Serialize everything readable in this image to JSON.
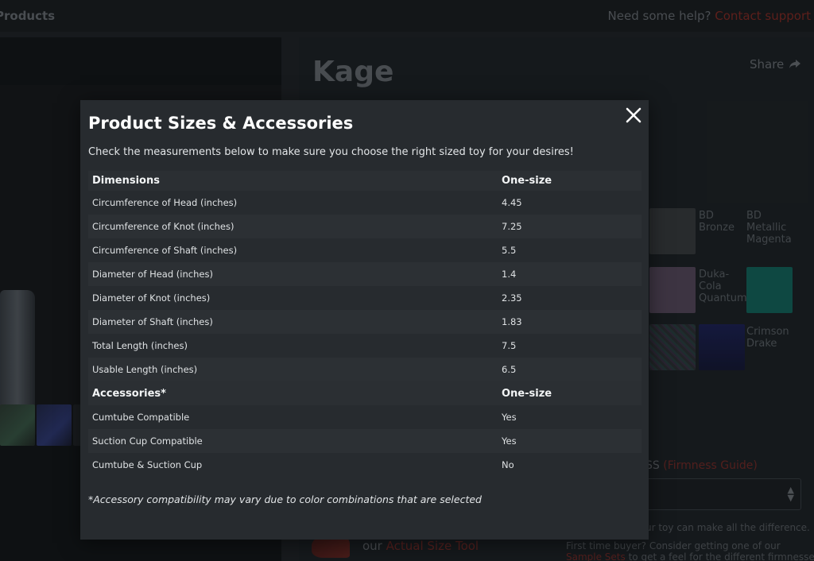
{
  "header": {
    "breadcrumb": "Products",
    "help_text": "Need some help?",
    "help_link": "Contact support"
  },
  "product": {
    "name": "Kage",
    "share_label": "Share"
  },
  "swatches": [
    {
      "label": "",
      "color": "#3a3c3e"
    },
    {
      "label": "BD Bronze",
      "color": ""
    },
    {
      "label": "BD Metallic Magenta",
      "color": ""
    },
    {
      "label": "",
      "color": "#5a4a5e"
    },
    {
      "label": "Duka-Cola Quantum",
      "color": ""
    },
    {
      "label": "",
      "color": "#12695e"
    },
    {
      "label": "",
      "color": "#2d3033"
    },
    {
      "label": "",
      "color": "#1a1e4a"
    },
    {
      "label": "Crimson Drake",
      "color": ""
    }
  ],
  "firmness": {
    "label_suffix": "SS",
    "guide_link": "(Firmness Guide)",
    "hint": "ur toy can make all the difference.",
    "first_time": "First time buyer? Consider getting one of our",
    "sample_link": "Sample Sets",
    "sample_rest": "to get a feel for the different firmnesses."
  },
  "size_tool": {
    "prefix": "our",
    "link": "Actual Size Tool"
  },
  "modal": {
    "title": "Product Sizes & Accessories",
    "subtitle": "Check the measurements below to make sure you choose the right sized toy for your desires!",
    "dimensions_header": {
      "label": "Dimensions",
      "value": "One-size"
    },
    "dimensions": [
      {
        "label": "Circumference of Head (inches)",
        "value": "4.45"
      },
      {
        "label": "Circumference of Knot (inches)",
        "value": "7.25"
      },
      {
        "label": "Circumference of Shaft (inches)",
        "value": "5.5"
      },
      {
        "label": "Diameter of Head (inches)",
        "value": "1.4"
      },
      {
        "label": "Diameter of Knot (inches)",
        "value": "2.35"
      },
      {
        "label": "Diameter of Shaft (inches)",
        "value": "1.83"
      },
      {
        "label": "Total Length (inches)",
        "value": "7.5"
      },
      {
        "label": "Usable Length (inches)",
        "value": "6.5"
      }
    ],
    "accessories_header": {
      "label": "Accessories*",
      "value": "One-size"
    },
    "accessories": [
      {
        "label": "Cumtube Compatible",
        "value": "Yes"
      },
      {
        "label": "Suction Cup Compatible",
        "value": "Yes"
      },
      {
        "label": "Cumtube & Suction Cup",
        "value": "No"
      }
    ],
    "footnote": "*Accessory compatibility may vary due to color combinations that are selected"
  },
  "colors": {
    "accent_link": "#8a2a22",
    "modal_bg": "#272b2f"
  }
}
